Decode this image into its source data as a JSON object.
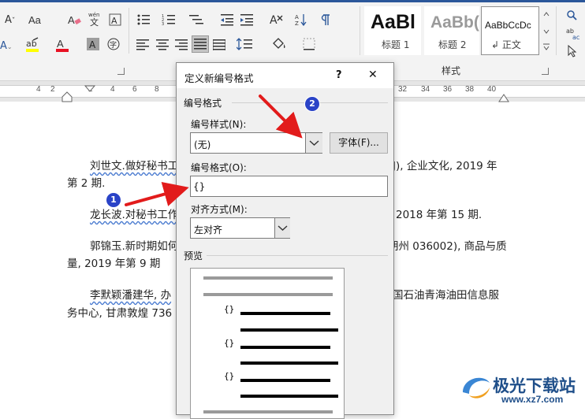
{
  "ribbon": {
    "styles": [
      {
        "sample": "AaBl",
        "name": "标题 1"
      },
      {
        "sample": "AaBb(",
        "name": "标题 2"
      },
      {
        "sample": "AaBbCcDc",
        "name": "↲ 正文"
      }
    ],
    "styles_group_label": "样式"
  },
  "ruler": {
    "numbers": [
      "4",
      "2",
      "2",
      "4",
      "6",
      "8",
      "32",
      "34",
      "36",
      "38",
      "40"
    ]
  },
  "document": {
    "lines": [
      {
        "left_text": "刘世文.做好秘书工",
        "right_text": "J), 企业文化, 2019 年"
      },
      {
        "left_text": "第 2 期.",
        "right_text": ""
      },
      {
        "left_text": "龙长波.对秘书工作",
        "right_text": "2018 年第 15 期."
      },
      {
        "left_text": "郭锦玉.新时期如何",
        "right_text": "朔州 036002), 商品与质"
      },
      {
        "left_text": "量, 2019 年第 9 期",
        "right_text": ""
      },
      {
        "left_text": "李默颖潘建华, 办",
        "right_text": "国石油青海油田信息服"
      },
      {
        "left_text": "务中心, 甘肃敦煌 736",
        "right_text": ""
      }
    ]
  },
  "dialog": {
    "title": "定义新编号格式",
    "help": "?",
    "close": "✕",
    "section_number_format": "编号格式",
    "style_label": "编号样式(N):",
    "style_value": "(无)",
    "font_button": "字体(F)...",
    "format_label": "编号格式(O):",
    "format_value": "{}",
    "align_label": "对齐方式(M):",
    "align_value": "左对齐",
    "preview_label": "预览",
    "preview_marker": "{}"
  },
  "annotations": {
    "marker_1": "1",
    "marker_2": "2"
  },
  "watermark": {
    "text": "极光下载站",
    "url": "www.xz7.com"
  },
  "colors": {
    "accent": "#2b579a",
    "arrow": "#e21b1b",
    "marker": "#2a43c7"
  }
}
